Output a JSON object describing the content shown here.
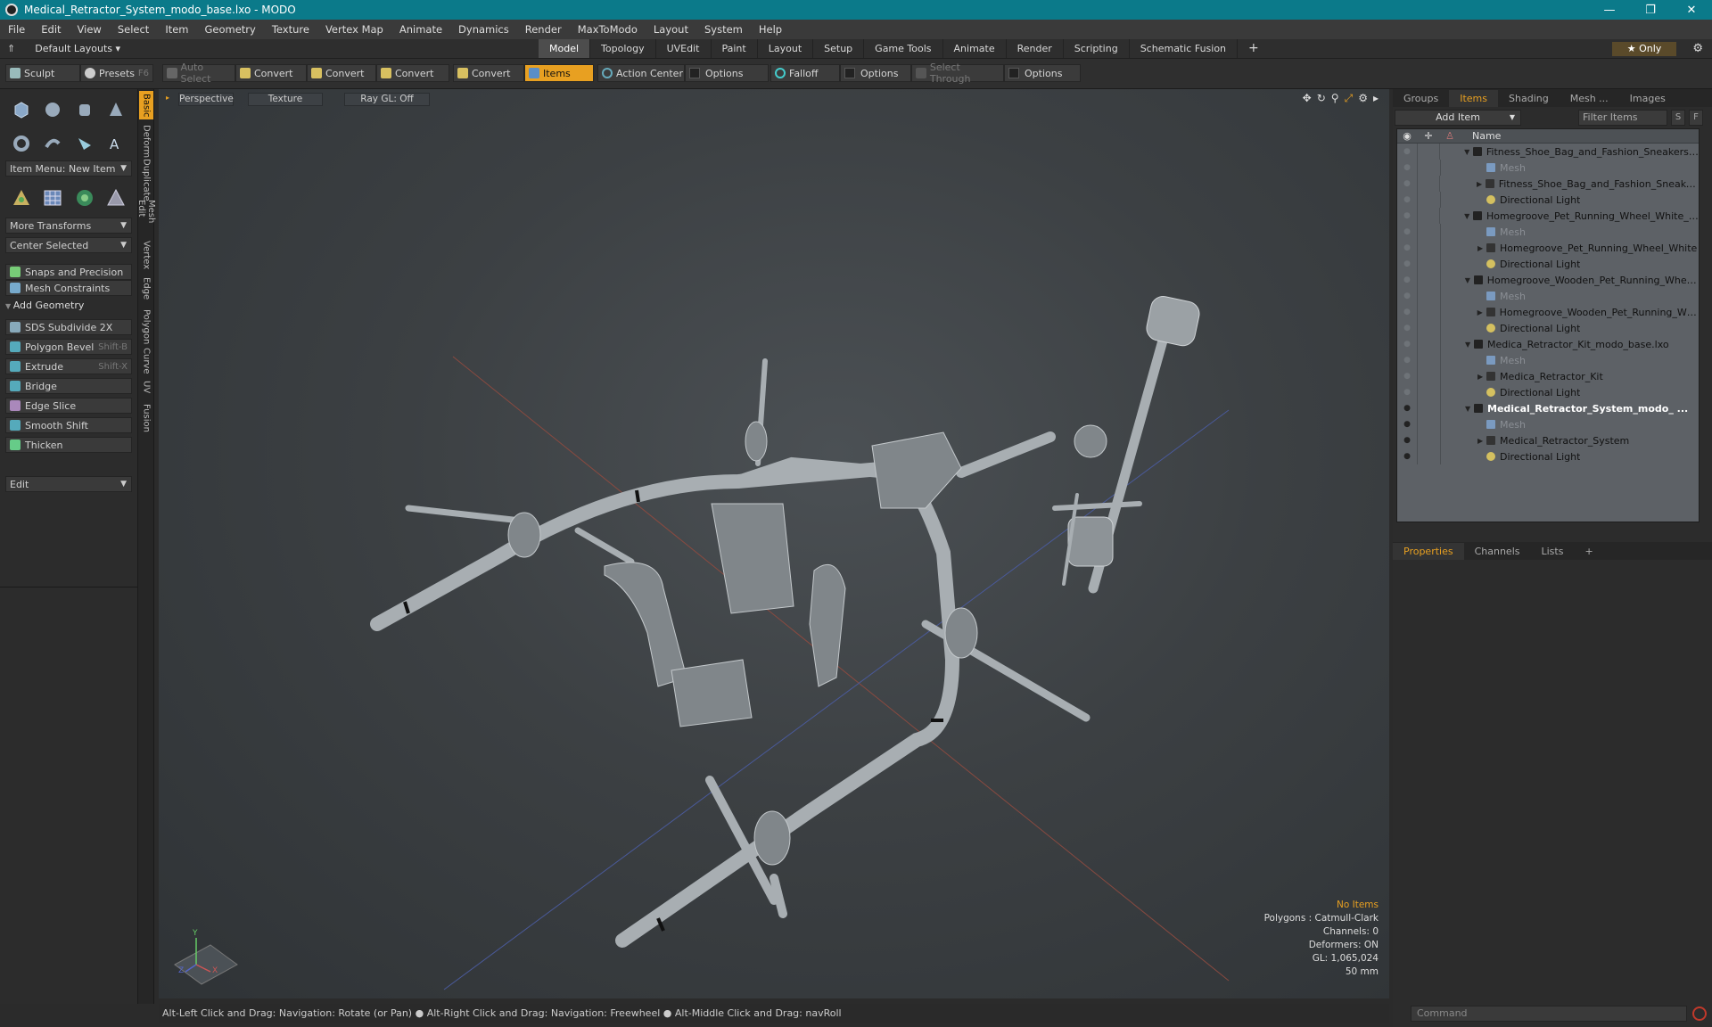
{
  "window": {
    "title": "Medical_Retractor_System_modo_base.lxo - MODO",
    "min": "—",
    "max": "❐",
    "close": "✕"
  },
  "menu": [
    "File",
    "Edit",
    "View",
    "Select",
    "Item",
    "Geometry",
    "Texture",
    "Vertex Map",
    "Animate",
    "Dynamics",
    "Render",
    "MaxToModo",
    "Layout",
    "System",
    "Help"
  ],
  "layout_bar": {
    "layouts": "Default Layouts ▾",
    "tabs": [
      "Model",
      "Topology",
      "UVEdit",
      "Paint",
      "Layout",
      "Setup",
      "Game Tools",
      "Animate",
      "Render",
      "Scripting",
      "Schematic Fusion"
    ],
    "active_tab": "Model",
    "plus": "+",
    "only": "★ Only"
  },
  "toolbar": {
    "sculpt": "Sculpt",
    "presets": "Presets",
    "presets_key": "F6",
    "auto_select": "Auto Select",
    "convert1": "Convert",
    "convert2": "Convert",
    "convert3": "Convert",
    "convert4": "Convert",
    "items": "Items",
    "action_center": "Action Center",
    "options1": "Options",
    "falloff": "Falloff",
    "options2": "Options",
    "select_through": "Select Through",
    "options3": "Options"
  },
  "left": {
    "item_menu": "Item Menu: New Item",
    "more_transforms": "More Transforms",
    "center_selected": "Center Selected",
    "snaps": "Snaps and Precision",
    "mesh_constraints": "Mesh Constraints",
    "add_geometry": "Add Geometry",
    "sds": "SDS Subdivide 2X",
    "polygon_bevel": "Polygon Bevel",
    "polygon_bevel_key": "Shift-B",
    "extrude": "Extrude",
    "extrude_key": "Shift-X",
    "bridge": "Bridge",
    "edge_slice": "Edge Slice",
    "smooth_shift": "Smooth Shift",
    "thicken": "Thicken",
    "edit": "Edit"
  },
  "vtabs": [
    "Basic",
    "Deform",
    "Duplicate",
    "Mesh Edit",
    "Vertex",
    "Edge",
    "Polygon",
    "Curve",
    "UV",
    "Fusion"
  ],
  "viewport": {
    "perspective": "Perspective",
    "texture": "Texture",
    "raygl": "Ray GL: Off",
    "info": {
      "no_items": "No Items",
      "polygons": "Polygons : Catmull-Clark",
      "channels": "Channels: 0",
      "deformers": "Deformers: ON",
      "gl": "GL: 1,065,024",
      "focal": "50 mm"
    },
    "axis_y": "Y",
    "axis_x": "X",
    "axis_z": "Z"
  },
  "status": "Alt-Left Click and Drag: Navigation: Rotate (or Pan) ● Alt-Right Click and Drag: Navigation: Freewheel ● Alt-Middle Click and Drag: navRoll",
  "right": {
    "tabs": [
      "Groups",
      "Items",
      "Shading",
      "Mesh ...",
      "Images"
    ],
    "active": "Items",
    "add_item": "Add Item",
    "filter": "Filter Items",
    "s": "S",
    "f": "F",
    "name_header": "Name",
    "rows": [
      {
        "name": "Fitness_Shoe_Bag_and_Fashion_Sneakers ...",
        "level": 0,
        "type": "scene"
      },
      {
        "name": "Mesh",
        "level": 1,
        "type": "mesh"
      },
      {
        "name": "Fitness_Shoe_Bag_and_Fashion_Sneakers",
        "level": 1,
        "type": "group"
      },
      {
        "name": "Directional Light",
        "level": 1,
        "type": "light"
      },
      {
        "name": "Homegroove_Pet_Running_Wheel_White_ ...",
        "level": 0,
        "type": "scene"
      },
      {
        "name": "Mesh",
        "level": 1,
        "type": "mesh"
      },
      {
        "name": "Homegroove_Pet_Running_Wheel_White",
        "level": 1,
        "type": "group"
      },
      {
        "name": "Directional Light",
        "level": 1,
        "type": "light"
      },
      {
        "name": "Homegroove_Wooden_Pet_Running_Whe ...",
        "level": 0,
        "type": "scene"
      },
      {
        "name": "Mesh",
        "level": 1,
        "type": "mesh"
      },
      {
        "name": "Homegroove_Wooden_Pet_Running_W ...",
        "level": 1,
        "type": "group"
      },
      {
        "name": "Directional Light",
        "level": 1,
        "type": "light"
      },
      {
        "name": "Medica_Retractor_Kit_modo_base.lxo",
        "level": 0,
        "type": "scene"
      },
      {
        "name": "Mesh",
        "level": 1,
        "type": "mesh"
      },
      {
        "name": "Medica_Retractor_Kit",
        "level": 1,
        "type": "group"
      },
      {
        "name": "Directional Light",
        "level": 1,
        "type": "light"
      },
      {
        "name": "Medical_Retractor_System_modo_ ...",
        "level": 0,
        "type": "scene",
        "selected": true
      },
      {
        "name": "Mesh",
        "level": 1,
        "type": "mesh"
      },
      {
        "name": "Medical_Retractor_System",
        "level": 1,
        "type": "group"
      },
      {
        "name": "Directional Light",
        "level": 1,
        "type": "light"
      }
    ],
    "props_tabs": [
      "Properties",
      "Channels",
      "Lists"
    ],
    "props_active": "Properties",
    "command": "Command"
  }
}
